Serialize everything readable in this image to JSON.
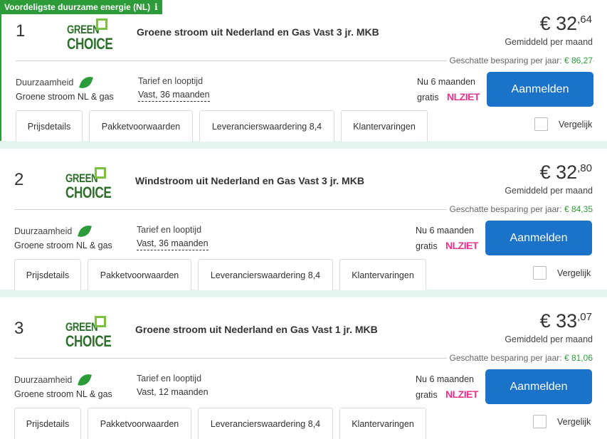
{
  "badge": {
    "label": "Voordeligste duurzame energie (NL)",
    "info_icon": "info-icon"
  },
  "colors": {
    "accent_green": "#2e9b3a",
    "button_blue": "#1a73c8",
    "nlziet_pink": "#e8348c"
  },
  "offers": [
    {
      "rank": "1",
      "logo": {
        "line1": "GREEN",
        "line2": "CHOICE"
      },
      "title": "Groene stroom uit Nederland en Gas Vast 3 jr. MKB",
      "price_euro": "€ 32",
      "price_cents": ",64",
      "price_caption": "Gemiddeld per maand",
      "savings_label": "Geschatte besparing per jaar: ",
      "savings_amount": "€ 86,27",
      "sustainability_label": "Duurzaamheid",
      "sustainability_value": "Groene stroom NL & gas",
      "tariff_label": "Tarief en looptijd",
      "tariff_value": "Vast, 36 maanden",
      "promo_line1": "Nu 6 maanden",
      "promo_line2": "gratis",
      "promo_brand": "NLZIET",
      "signup_label": "Aanmelden",
      "tabs": [
        "Prijsdetails",
        "Pakketvoorwaarden",
        "Leverancierswaardering 8,4",
        "Klantervaringen"
      ],
      "compare_label": "Vergelijk"
    },
    {
      "rank": "2",
      "logo": {
        "line1": "GREEN",
        "line2": "CHOICE"
      },
      "title": "Windstroom uit Nederland en Gas Vast 3 jr. MKB",
      "price_euro": "€ 32",
      "price_cents": ",80",
      "price_caption": "Gemiddeld per maand",
      "savings_label": "Geschatte besparing per jaar: ",
      "savings_amount": "€ 84,35",
      "sustainability_label": "Duurzaamheid",
      "sustainability_value": "Groene stroom NL & gas",
      "tariff_label": "Tarief en looptijd",
      "tariff_value": "Vast, 36 maanden",
      "promo_line1": "Nu 6 maanden",
      "promo_line2": "gratis",
      "promo_brand": "NLZIET",
      "signup_label": "Aanmelden",
      "tabs": [
        "Prijsdetails",
        "Pakketvoorwaarden",
        "Leverancierswaardering 8,4",
        "Klantervaringen"
      ],
      "compare_label": "Vergelijk"
    },
    {
      "rank": "3",
      "logo": {
        "line1": "GREEN",
        "line2": "CHOICE"
      },
      "title": "Groene stroom uit Nederland en Gas Vast 1 jr. MKB",
      "price_euro": "€ 33",
      "price_cents": ",07",
      "price_caption": "Gemiddeld per maand",
      "savings_label": "Geschatte besparing per jaar: ",
      "savings_amount": "€ 81,06",
      "sustainability_label": "Duurzaamheid",
      "sustainability_value": "Groene stroom NL & gas",
      "tariff_label": "Tarief en looptijd",
      "tariff_value": "Vast, 12 maanden",
      "promo_line1": "Nu 6 maanden",
      "promo_line2": "gratis",
      "promo_brand": "NLZIET",
      "signup_label": "Aanmelden",
      "tabs": [
        "Prijsdetails",
        "Pakketvoorwaarden",
        "Leverancierswaardering 8,4",
        "Klantervaringen"
      ],
      "compare_label": "Vergelijk"
    }
  ]
}
